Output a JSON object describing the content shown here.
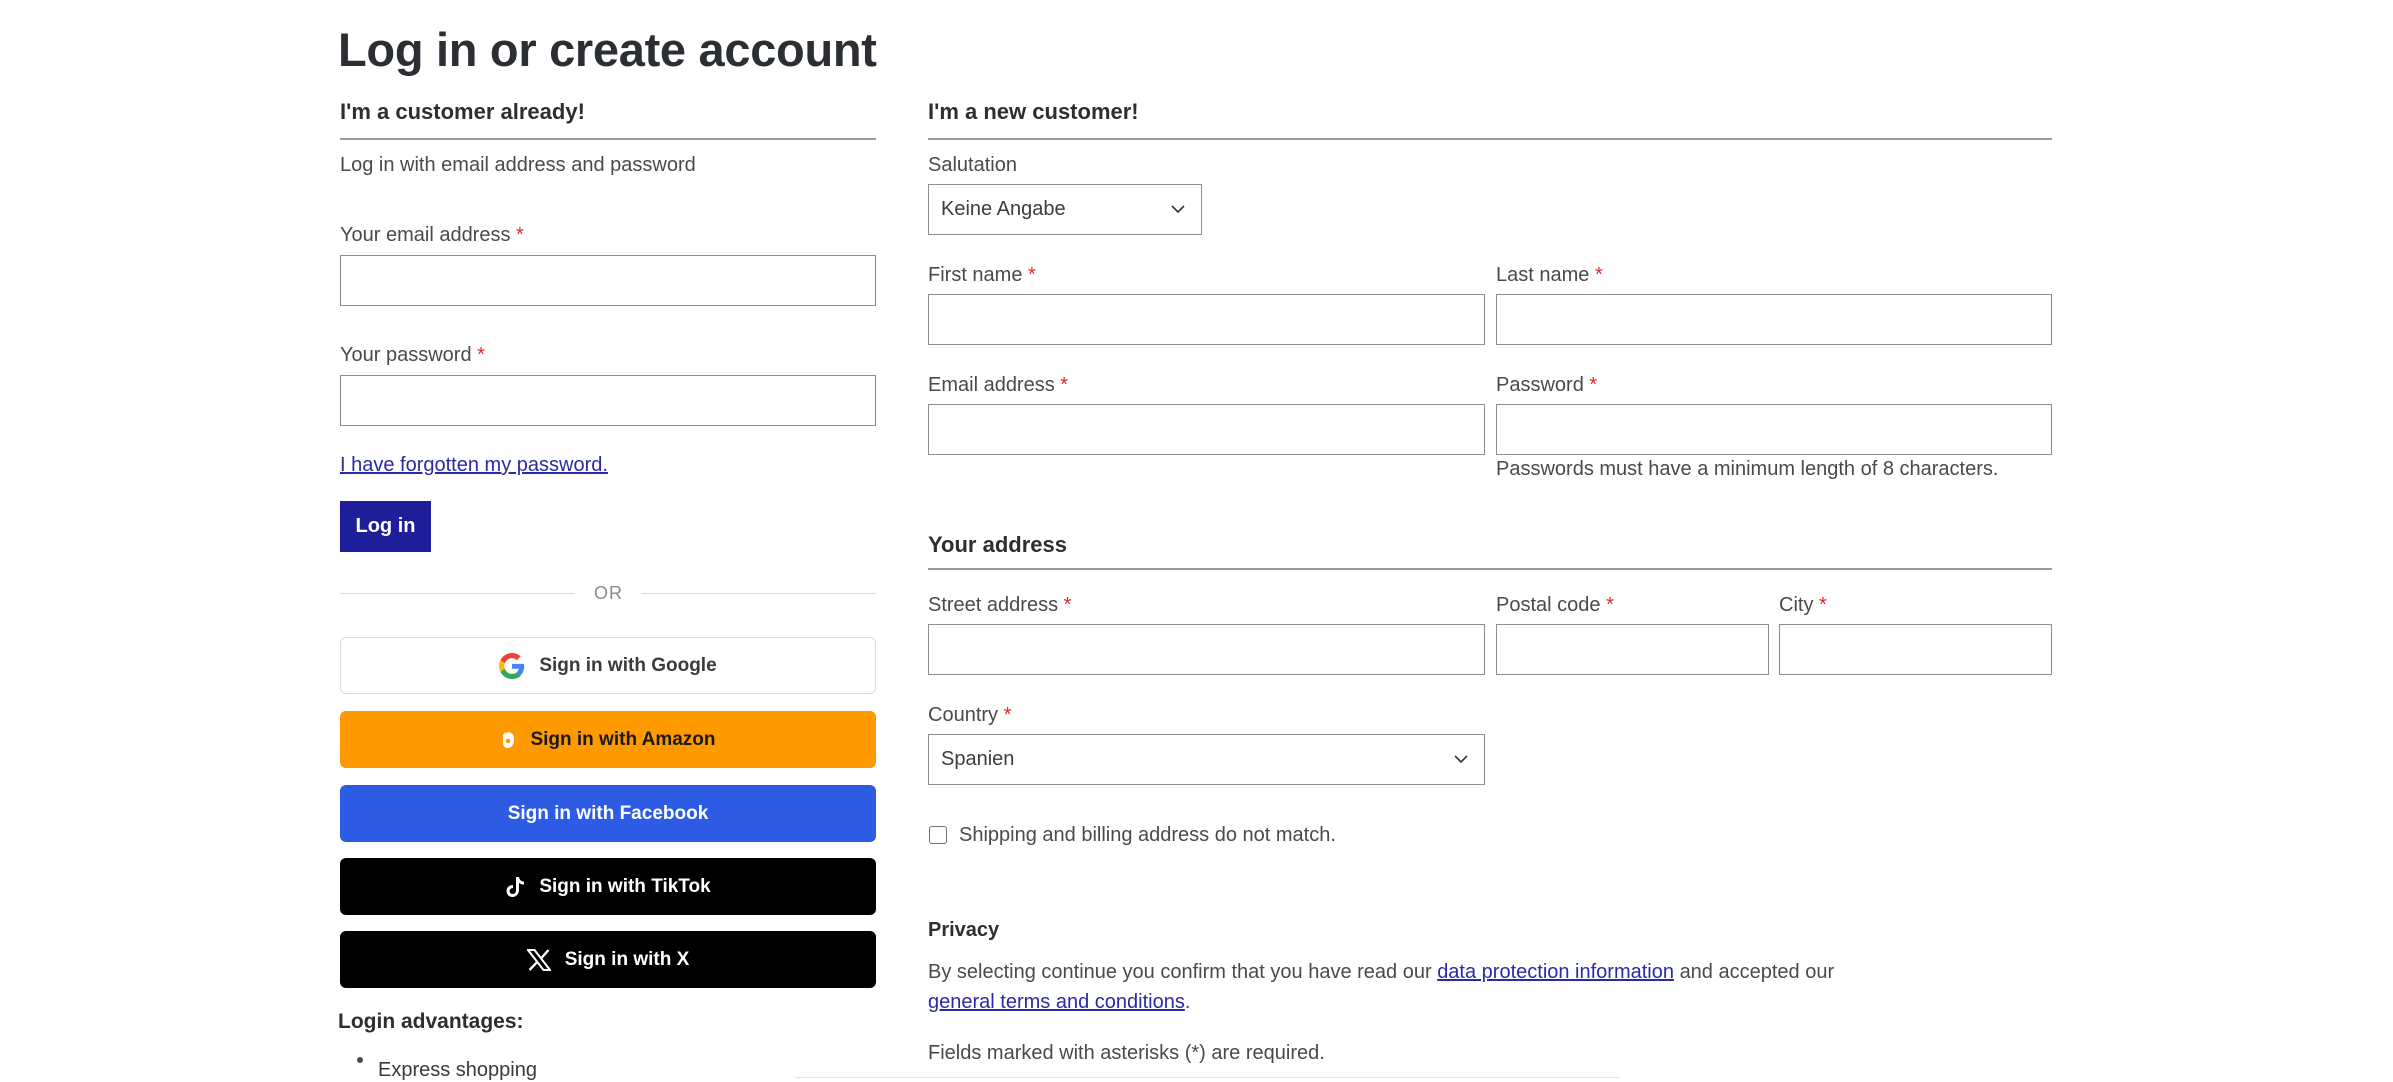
{
  "page": {
    "title": "Log in or create account"
  },
  "login": {
    "heading": "I'm a customer already!",
    "intro": "Log in with email address and password",
    "email_label": "Your email address",
    "password_label": "Your password",
    "required_mark": "*",
    "forgot_link": "I have forgotten my password.",
    "login_button": "Log in",
    "or_text": "OR"
  },
  "social": [
    {
      "label": "Sign in with Google",
      "icon": "google-icon"
    },
    {
      "label": "Sign in with Amazon",
      "icon": "amazon-icon"
    },
    {
      "label": "Sign in with Facebook",
      "icon": ""
    },
    {
      "label": "Sign in with TikTok",
      "icon": "tiktok-icon"
    },
    {
      "label": "Sign in with X",
      "icon": "x-icon"
    }
  ],
  "advantages": {
    "heading": "Login advantages:",
    "items": [
      "Express shopping"
    ]
  },
  "register": {
    "heading": "I'm a new customer!",
    "salutation_label": "Salutation",
    "salutation_value": "Keine Angabe",
    "first_name_label": "First name",
    "last_name_label": "Last name",
    "email_label": "Email address",
    "password_label": "Password",
    "password_hint": "Passwords must have a minimum length of 8 characters.",
    "address_heading": "Your address",
    "street_label": "Street address",
    "postal_label": "Postal code",
    "city_label": "City",
    "country_label": "Country",
    "country_value": "Spanien",
    "shipping_checkbox_label": "Shipping and billing address do not match.",
    "privacy_heading": "Privacy",
    "privacy_text_1": "By selecting continue you confirm that you have read our",
    "privacy_link_1": "data protection information",
    "privacy_text_2": "and accepted our",
    "privacy_link_2": "general terms and conditions",
    "privacy_text_3": ".",
    "required_note": "Fields marked with asterisks (*) are required."
  },
  "colors": {
    "primary_button": "#1e1e9b",
    "amazon": "#ff9900",
    "facebook": "#2d5be3",
    "tiktok": "#000000",
    "x": "#000000",
    "required": "#e0252b",
    "link": "#2a2aa8"
  }
}
